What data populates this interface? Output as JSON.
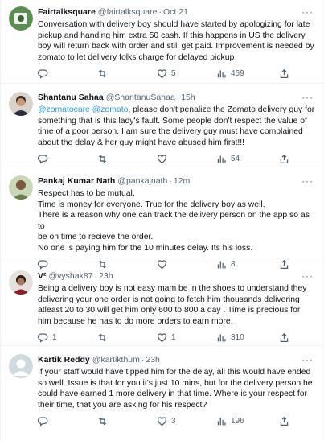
{
  "tweets": [
    {
      "name": "Fairtalksquare",
      "handle": "@fairtalksquare",
      "time": "Oct 21",
      "lines": [
        "Conversation with delivery boy should have started by apologizing for late",
        "pickup and handing him extra 50 cash. If this happens in US the delivery",
        "boy will return back with order and still get paid. Improvement is needed by",
        "zomato to let delivery folks charge for delayed pickup"
      ],
      "replies": "",
      "retweets": "",
      "likes": "5",
      "views": "469"
    },
    {
      "name": "Shantanu Sahaa",
      "handle": "@ShantanuSahaa",
      "time": "15h",
      "mention1": "@zomatocare",
      "mention2": "@zomato",
      "first_line_rest": ", please don't penalize the Zomato delivery guy for",
      "lines": [
        "something that is this lady's fault. Some people don't respect the value of",
        "time of a poor person. I am sure the delivery guy must have complained",
        "about the delay & her guy might have abused him first!!!"
      ],
      "replies": "",
      "retweets": "",
      "likes": "",
      "views": "54"
    },
    {
      "name": "Pankaj Kumar Nath",
      "handle": "@pankajnath",
      "time": "12m",
      "lines": [
        "Respect has to be mutual.",
        "Time is money for everyone. True for the delivery boy as well.",
        "There is a reason why one can track the delivery person on the app so as to",
        "be on time to recieve the order.",
        "No one is paying him for the 10 minutes delay. Its his loss."
      ],
      "replies": "",
      "retweets": "",
      "likes": "",
      "views": "8"
    },
    {
      "name": "V²",
      "handle": "@vyshak87",
      "time": "23h",
      "lines": [
        "Being a delivery boy is not easy mam be in the shoes to understand they",
        "delivering your one order is not going to fetch him thousands delivering",
        "atleast 20 to 30 will get him only 600 to 800 a day . Time is precious for",
        "him because he has to do more orders to earn more."
      ],
      "replies": "1",
      "retweets": "",
      "likes": "1",
      "views": "310"
    },
    {
      "name": "Kartik Reddy",
      "handle": "@kartikthum",
      "time": "23h",
      "lines": [
        "If your staff would have tipped him for the delay, all this would have ended",
        "so well. Issue is that for you it's just 10 mins, but for the delivery person he",
        "could have earned 1 more delivery in that time. Where is your respect for",
        "their time, that you are asking for his respect?"
      ],
      "replies": "",
      "retweets": "",
      "likes": "3",
      "views": "196"
    }
  ],
  "dot": "·",
  "more": "···",
  "icons": [
    "reply-icon",
    "retweet-icon",
    "like-icon",
    "views-icon",
    "share-icon"
  ],
  "colors": {
    "mention": "#1d9bf0",
    "muted": "#536471",
    "text": "#0f1419",
    "divider": "#eff3f4"
  }
}
